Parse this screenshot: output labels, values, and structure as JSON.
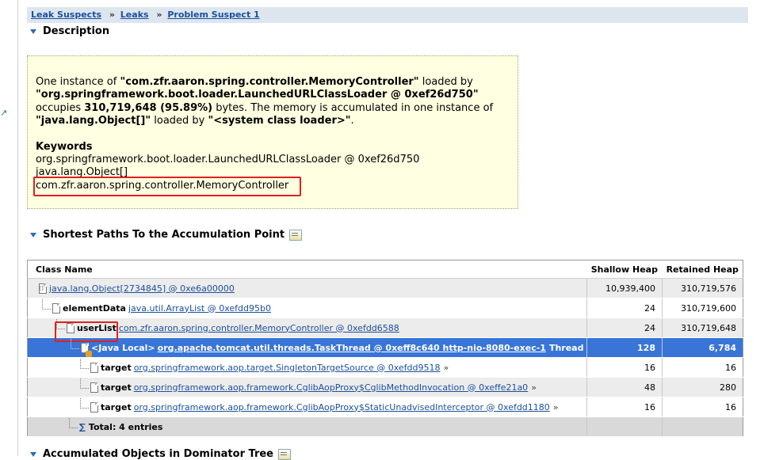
{
  "breadcrumb": [
    {
      "label": "Leak Suspects"
    },
    {
      "label": "Leaks"
    },
    {
      "label": "Problem Suspect 1"
    }
  ],
  "breadcrumb_separator": "»",
  "description": {
    "title": "Description",
    "intro": "One instance of ",
    "class_name": "\"com.zfr.aaron.spring.controller.MemoryController\"",
    "loaded_by": " loaded by ",
    "loader": "\"org.springframework.boot.loader.LaunchedURLClassLoader @ 0xef26d750\"",
    "occupies": " occupies ",
    "bytes_value": "310,719,648 (95.89%)",
    "bytes_suffix": " bytes. The memory is accumulated in one instance of ",
    "array_class": "\"java.lang.Object[]\"",
    "loaded_by2": " loaded by ",
    "system_loader": "\"<system class loader>\"",
    "period": ".",
    "keywords_title": "Keywords",
    "keywords": [
      "org.springframework.boot.loader.LaunchedURLClassLoader @ 0xef26d750",
      "java.lang.Object[]",
      "com.zfr.aaron.spring.controller.MemoryController"
    ]
  },
  "paths": {
    "title": "Shortest Paths To the Accumulation Point",
    "columns": [
      "Class Name",
      "Shallow Heap",
      "Retained Heap"
    ],
    "rows": [
      {
        "field": "",
        "object": "java.lang.Object[2734845] @ 0xe6a00000",
        "suffix": "",
        "more": "",
        "shallow": "10,939,400",
        "retained": "310,719,576"
      },
      {
        "field": "elementData",
        "object": "java.util.ArrayList @ 0xefdd95b0",
        "suffix": "",
        "more": "",
        "shallow": "24",
        "retained": "310,719,600"
      },
      {
        "field": "userList",
        "object": "com.zfr.aaron.spring.controller.MemoryController @ 0xefdd6588",
        "suffix": "",
        "more": "",
        "shallow": "24",
        "retained": "310,719,648"
      },
      {
        "field": "<Java Local>",
        "object": "org.apache.tomcat.util.threads.TaskThread @ 0xeff8c640 http-nio-8080-exec-1",
        "suffix": "Thread",
        "more": "",
        "shallow": "128",
        "retained": "6,784"
      },
      {
        "field": "target",
        "object": "org.springframework.aop.target.SingletonTargetSource @ 0xefdd9518",
        "suffix": "",
        "more": "»",
        "shallow": "16",
        "retained": "16"
      },
      {
        "field": "target",
        "object": "org.springframework.aop.framework.CglibAopProxy$CglibMethodInvocation @ 0xeffe21a0",
        "suffix": "",
        "more": "»",
        "shallow": "48",
        "retained": "280"
      },
      {
        "field": "target",
        "object": "org.springframework.aop.framework.CglibAopProxy$StaticUnadvisedInterceptor @ 0xefdd1180",
        "suffix": "",
        "more": "»",
        "shallow": "16",
        "retained": "16"
      }
    ],
    "total_symbol": "∑",
    "total": "Total: 4 entries"
  },
  "next_section_title": "Accumulated Objects in Dominator Tree",
  "colors": {
    "selection": "#3875d7",
    "highlight": "#e02020",
    "link": "#1b4f9c",
    "description_bg": "#ffffe1"
  }
}
